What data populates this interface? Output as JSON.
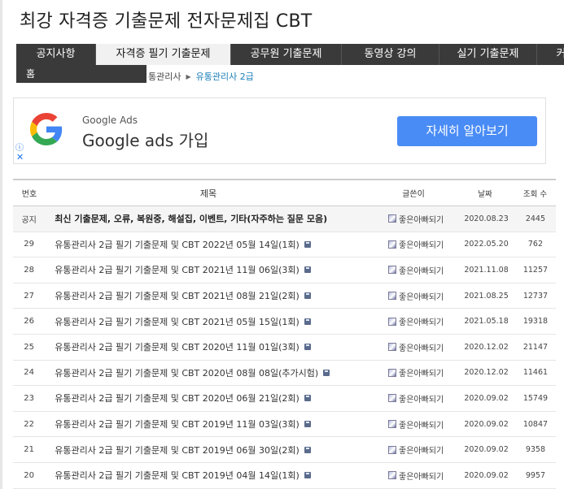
{
  "site": {
    "title": "최강 자격증 기출문제 전자문제집 CBT"
  },
  "nav": {
    "items": [
      {
        "label": "공지사항"
      },
      {
        "label": "자격증 필기 기출문제"
      },
      {
        "label": "공무원 기출문제"
      },
      {
        "label": "동영상 강의"
      },
      {
        "label": "실기 기출문제"
      },
      {
        "label": "커"
      }
    ]
  },
  "submenu": {
    "label": "홈"
  },
  "breadcrumb": {
    "partial": "통관리사",
    "current": "유통관리사 2급"
  },
  "ad": {
    "brand_small": "Google Ads",
    "headline": "Google ads 가입",
    "cta": "자세히 알아보기",
    "info_icon": "info-icon",
    "close_icon": "close-icon"
  },
  "board": {
    "headers": {
      "num": "번호",
      "title": "제목",
      "author": "글쓴이",
      "date": "날짜",
      "views": "조회 수"
    },
    "notice": {
      "num": "공지",
      "title": "최신 기출문제, 오류, 복원중, 해설집, 이벤트, 기타(자주하는 질문 모음)",
      "author": "좋은아빠되기",
      "date": "2020.08.23",
      "views": "2445"
    },
    "rows": [
      {
        "num": "29",
        "title": "유통관리사 2급 필기 기출문제 및 CBT 2022년 05월 14일(1회)",
        "author": "좋은아빠되기",
        "date": "2022.05.20",
        "views": "762"
      },
      {
        "num": "28",
        "title": "유통관리사 2급 필기 기출문제 및 CBT 2021년 11월 06일(3회)",
        "author": "좋은아빠되기",
        "date": "2021.11.08",
        "views": "11257"
      },
      {
        "num": "27",
        "title": "유통관리사 2급 필기 기출문제 및 CBT 2021년 08월 21일(2회)",
        "author": "좋은아빠되기",
        "date": "2021.08.25",
        "views": "12737"
      },
      {
        "num": "26",
        "title": "유통관리사 2급 필기 기출문제 및 CBT 2021년 05월 15일(1회)",
        "author": "좋은아빠되기",
        "date": "2021.05.18",
        "views": "19318"
      },
      {
        "num": "25",
        "title": "유통관리사 2급 필기 기출문제 및 CBT 2020년 11월 01일(3회)",
        "author": "좋은아빠되기",
        "date": "2020.12.02",
        "views": "21147"
      },
      {
        "num": "24",
        "title": "유통관리사 2급 필기 기출문제 및 CBT 2020년 08월 08일(추가시험)",
        "author": "좋은아빠되기",
        "date": "2020.12.02",
        "views": "11461"
      },
      {
        "num": "23",
        "title": "유통관리사 2급 필기 기출문제 및 CBT 2020년 06월 21일(2회)",
        "author": "좋은아빠되기",
        "date": "2020.09.02",
        "views": "15749"
      },
      {
        "num": "22",
        "title": "유통관리사 2급 필기 기출문제 및 CBT 2019년 11월 03일(3회)",
        "author": "좋은아빠되기",
        "date": "2020.09.02",
        "views": "10847"
      },
      {
        "num": "21",
        "title": "유통관리사 2급 필기 기출문제 및 CBT 2019년 06월 30일(2회)",
        "author": "좋은아빠되기",
        "date": "2020.09.02",
        "views": "9358"
      },
      {
        "num": "20",
        "title": "유통관리사 2급 필기 기출문제 및 CBT 2019년 04월 14일(1회)",
        "author": "좋은아빠되기",
        "date": "2020.09.02",
        "views": "9957"
      }
    ]
  },
  "colors": {
    "nav_bg": "#3a3a3a",
    "link": "#1a7fb8",
    "ad_button": "#4a8cf5"
  }
}
